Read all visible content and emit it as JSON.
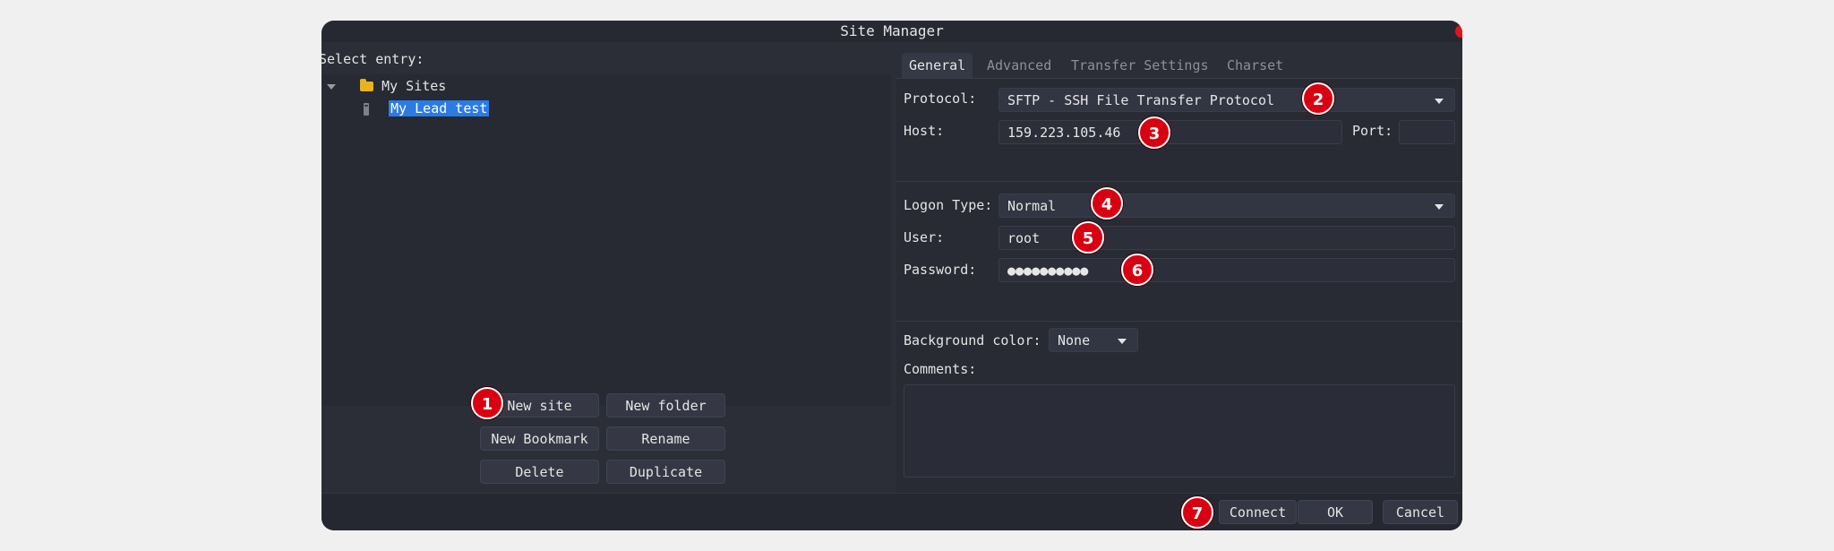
{
  "window": {
    "title": "Site Manager"
  },
  "tree": {
    "select_label": "Select entry:",
    "folder_label": "My Sites",
    "site_label": "My Lead test"
  },
  "buttons": {
    "new_site": "New site",
    "new_folder": "New folder",
    "new_bookmark": "New Bookmark",
    "rename": "Rename",
    "delete": "Delete",
    "duplicate": "Duplicate",
    "connect": "Connect",
    "ok": "OK",
    "cancel": "Cancel"
  },
  "tabs": [
    "General",
    "Advanced",
    "Transfer Settings",
    "Charset"
  ],
  "general": {
    "protocol_label": "Protocol:",
    "protocol_value": "SFTP - SSH File Transfer Protocol",
    "host_label": "Host:",
    "host_value": "159.223.105.46",
    "port_label": "Port:",
    "port_value": "",
    "logon_type_label": "Logon Type:",
    "logon_type_value": "Normal",
    "user_label": "User:",
    "user_value": "root",
    "password_label": "Password:",
    "password_value": "●●●●●●●●●●",
    "bg_color_label": "Background color:",
    "bg_color_value": "None",
    "comments_label": "Comments:"
  },
  "annotations": [
    "1",
    "2",
    "3",
    "4",
    "5",
    "6",
    "7"
  ],
  "colors": {
    "selection": "#2a7be6",
    "badge": "#d90012",
    "folder": "#e8b31e",
    "close": "#e0161b"
  }
}
